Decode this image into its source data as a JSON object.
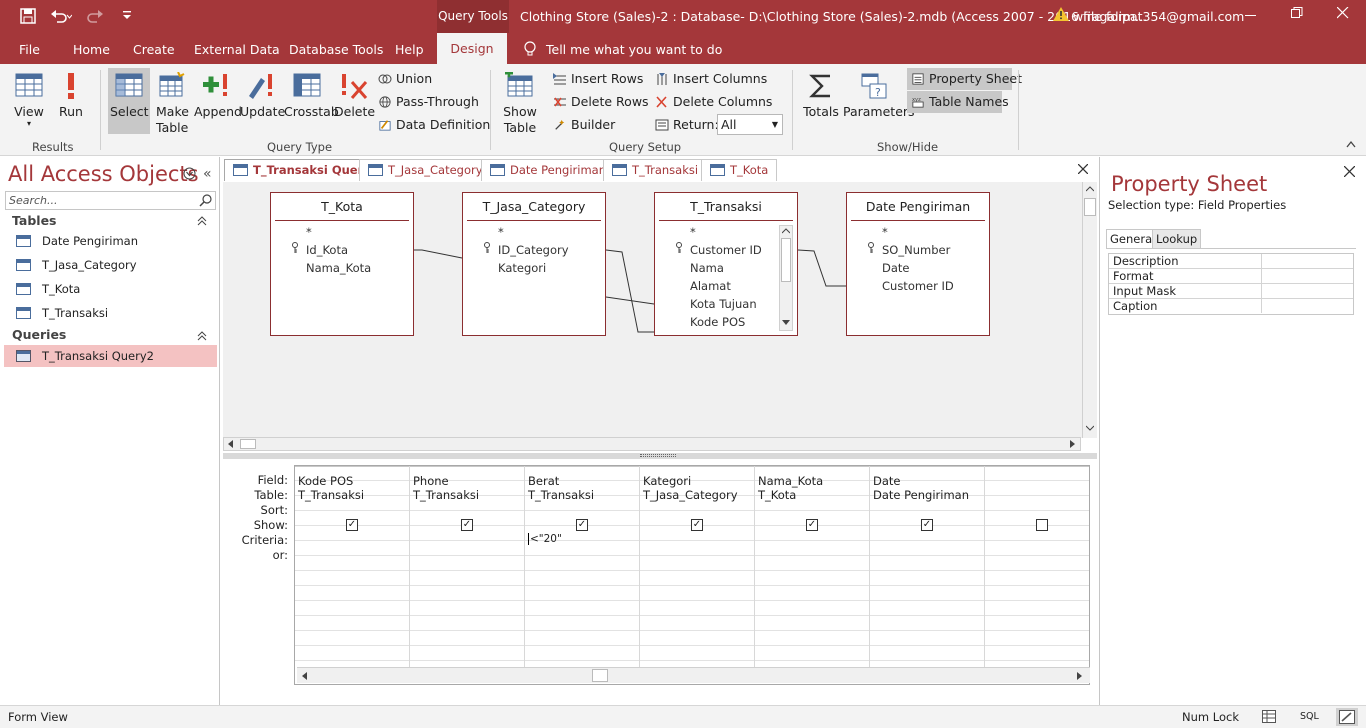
{
  "titlebar": {
    "contextual_tab": "Query Tools",
    "document_title": "Clothing Store (Sales)-2 : Database- D:\\Clothing Store (Sales)-2.mdb (Access 2007 - 2016 file form...",
    "user": "wiragalipat354@gmail.com"
  },
  "menu": {
    "file": "File",
    "home": "Home",
    "create": "Create",
    "external_data": "External Data",
    "database_tools": "Database Tools",
    "help": "Help",
    "design": "Design",
    "tell_me": "Tell me what you want to do"
  },
  "ribbon": {
    "results": {
      "group": "Results",
      "view": "View",
      "run": "Run"
    },
    "query_type": {
      "group": "Query Type",
      "select": "Select",
      "make_table": "Make Table",
      "append": "Append",
      "update": "Update",
      "crosstab": "Crosstab",
      "delete": "Delete",
      "union": "Union",
      "pass_through": "Pass-Through",
      "data_definition": "Data Definition"
    },
    "query_setup": {
      "group": "Query Setup",
      "show_table": "Show Table",
      "insert_rows": "Insert Rows",
      "delete_rows": "Delete Rows",
      "builder": "Builder",
      "insert_columns": "Insert Columns",
      "delete_columns": "Delete Columns",
      "return_label": "Return:",
      "return_value": "All"
    },
    "show_hide": {
      "group": "Show/Hide",
      "totals": "Totals",
      "parameters": "Parameters",
      "property_sheet": "Property Sheet",
      "table_names": "Table Names"
    }
  },
  "nav": {
    "title": "All Access Objects",
    "search_placeholder": "Search...",
    "tables_header": "Tables",
    "tables": [
      "Date Pengiriman",
      "T_Jasa_Category",
      "T_Kota",
      "T_Transaksi"
    ],
    "queries_header": "Queries",
    "queries": [
      "T_Transaksi Query2"
    ]
  },
  "doc_tabs": [
    "T_Transaksi Query2",
    "T_Jasa_Category",
    "Date Pengiriman",
    "T_Transaksi",
    "T_Kota"
  ],
  "design_tables": [
    {
      "name": "T_Kota",
      "fields": [
        "*",
        "Id_Kota",
        "Nama_Kota"
      ]
    },
    {
      "name": "T_Jasa_Category",
      "fields": [
        "*",
        "ID_Category",
        "Kategori"
      ]
    },
    {
      "name": "T_Transaksi",
      "fields": [
        "*",
        "Customer ID",
        "Nama",
        "Alamat",
        "Kota Tujuan",
        "Kode POS"
      ]
    },
    {
      "name": "Date Pengiriman",
      "fields": [
        "*",
        "SO_Number",
        "Date",
        "Customer ID"
      ]
    }
  ],
  "grid": {
    "row_labels": [
      "Field:",
      "Table:",
      "Sort:",
      "Show:",
      "Criteria:",
      "or:"
    ],
    "columns": [
      {
        "field": "Kode POS",
        "table": "T_Transaksi",
        "show": true,
        "criteria": ""
      },
      {
        "field": "Phone",
        "table": "T_Transaksi",
        "show": true,
        "criteria": ""
      },
      {
        "field": "Berat",
        "table": "T_Transaksi",
        "show": true,
        "criteria": "<\"20\""
      },
      {
        "field": "Kategori",
        "table": "T_Jasa_Category",
        "show": true,
        "criteria": ""
      },
      {
        "field": "Nama_Kota",
        "table": "T_Kota",
        "show": true,
        "criteria": ""
      },
      {
        "field": "Date",
        "table": "Date Pengiriman",
        "show": true,
        "criteria": ""
      },
      {
        "field": "",
        "table": "",
        "show": false,
        "criteria": ""
      }
    ]
  },
  "property_sheet": {
    "title": "Property Sheet",
    "selection_type": "Selection type:  Field Properties",
    "tab_general": "General",
    "tab_lookup": "Lookup",
    "properties": [
      "Description",
      "Format",
      "Input Mask",
      "Caption"
    ]
  },
  "status": {
    "left": "Form View",
    "num_lock": "Num Lock",
    "sql": "SQL"
  },
  "colors": {
    "accent": "#a4373a",
    "ribbon_bg": "#f3f3f3"
  }
}
